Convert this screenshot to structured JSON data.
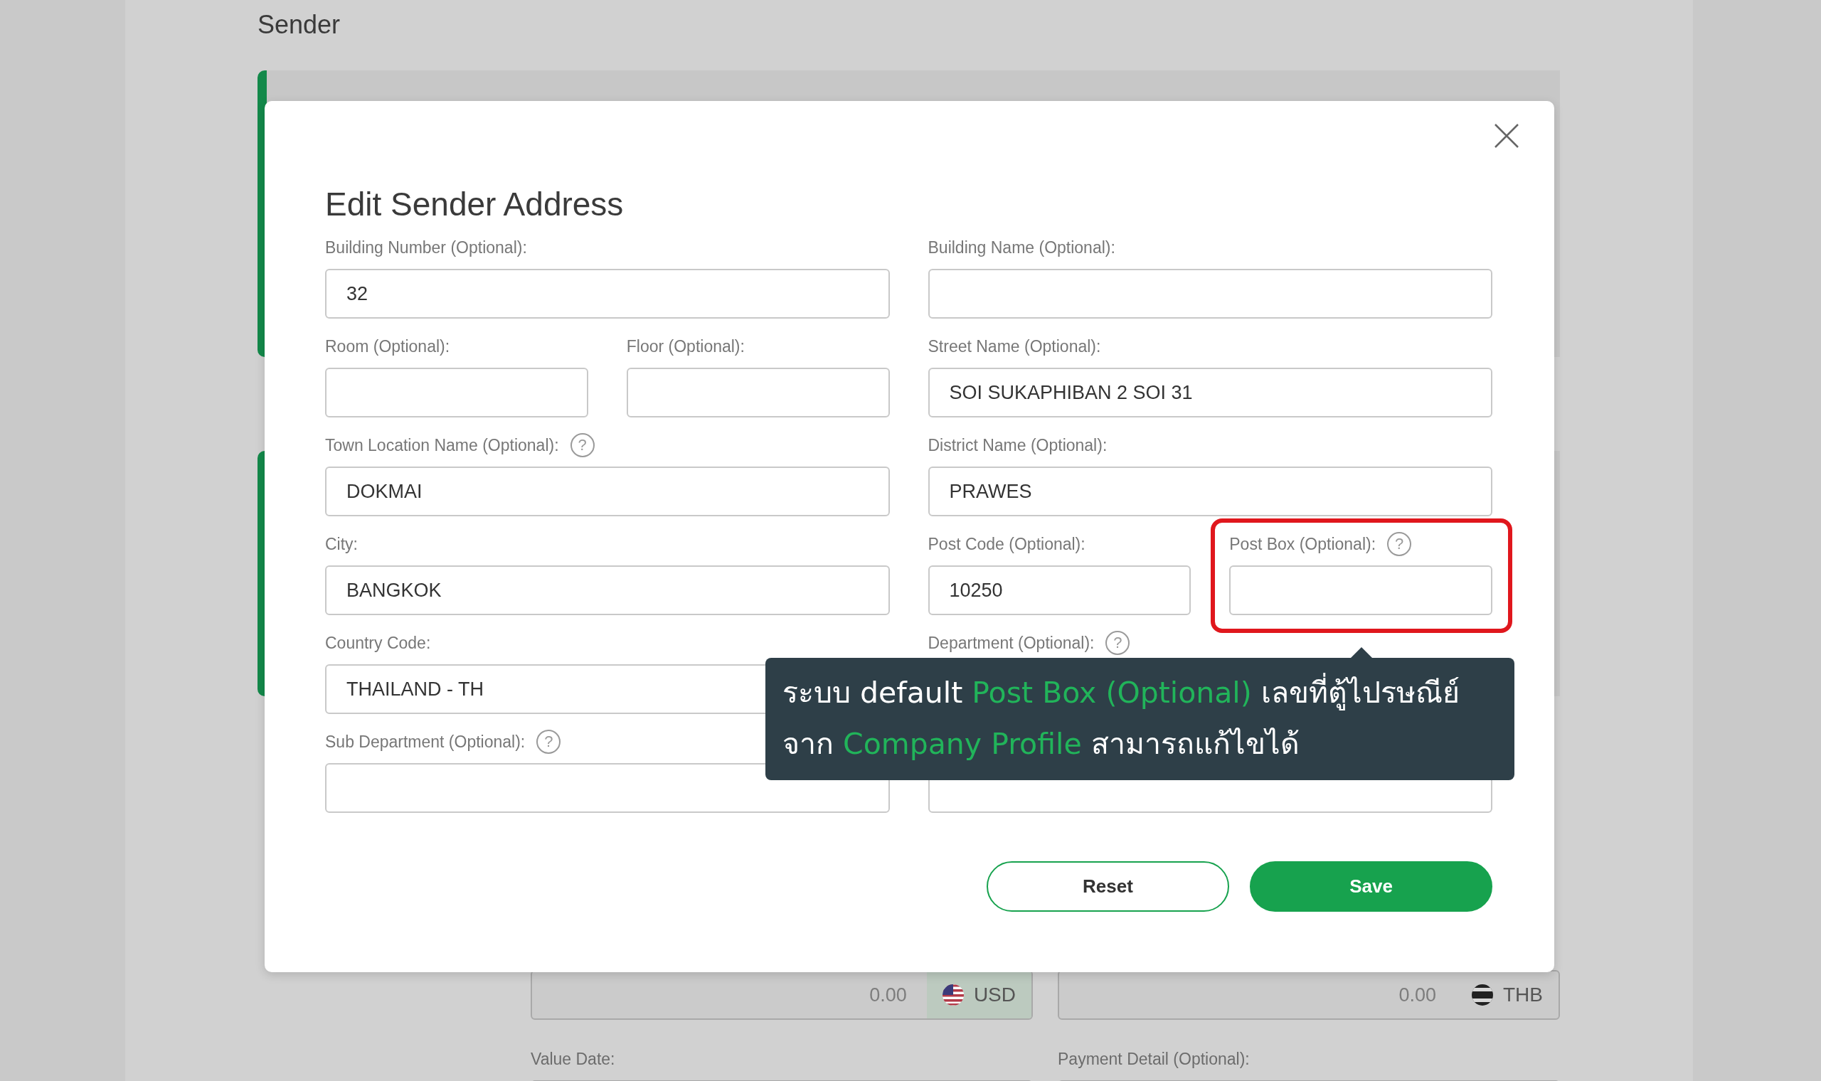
{
  "background": {
    "heading": "Sender",
    "amounts": [
      {
        "placeholder": "0.00",
        "currency": "USD",
        "kind": "us"
      },
      {
        "placeholder": "0.00",
        "currency": "THB",
        "kind": "thai"
      }
    ],
    "bottom_labels": [
      "Value Date:",
      "Payment Detail (Optional):"
    ]
  },
  "modal": {
    "title": "Edit Sender Address",
    "fields": [
      {
        "label": "Building Number (Optional):",
        "value": "32",
        "highlighted": false
      },
      {
        "label": "Building Name (Optional):",
        "highlighted": false
      },
      {
        "label": "Room (Optional):",
        "highlighted": false
      },
      {
        "label": "Floor (Optional):",
        "highlighted": false
      },
      {
        "label": "Street Name (Optional):",
        "value": "SOI SUKAPHIBAN 2 SOI 31",
        "highlighted": false
      },
      {
        "label": "Town Location Name (Optional):",
        "help": "?",
        "value": "DOKMAI",
        "highlighted": false
      },
      {
        "label": "District Name (Optional):",
        "value": "PRAWES",
        "highlighted": false
      },
      {
        "label": "City:",
        "value": "BANGKOK",
        "highlighted": false
      },
      {
        "label": "Post Code (Optional):",
        "value": "10250",
        "highlighted": false
      },
      {
        "label": "Post Box (Optional):",
        "help": "?",
        "highlighted": true
      },
      {
        "label": "Country Code:",
        "value": "THAILAND - TH",
        "highlighted": false
      },
      {
        "label": "Department (Optional):",
        "help": "?",
        "highlighted": false
      },
      {
        "label": "Sub Department (Optional):",
        "help": "?",
        "highlighted": false
      },
      {
        "highlighted": false
      }
    ],
    "tooltip": {
      "lines": [
        "ระบบ default **Post Box (Optional)** เลขที่ตู้ไปรษณีย์",
        "จาก **Company Profile** สามารถแก้ไขได้"
      ]
    },
    "buttons": [
      {
        "label": "Reset",
        "kind": "outline"
      },
      {
        "label": "Save",
        "kind": "primary"
      }
    ]
  }
}
